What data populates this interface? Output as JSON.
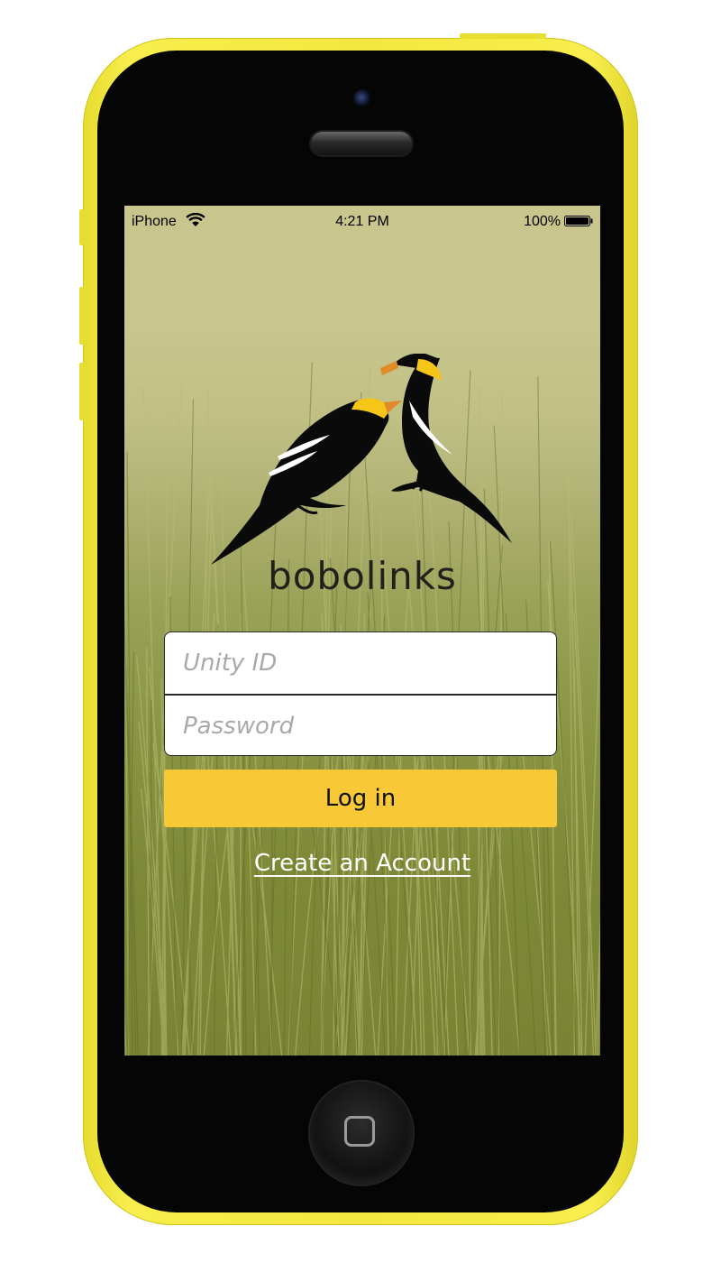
{
  "device": {
    "frame_color": "#f3e83e",
    "face_color": "#050505"
  },
  "status_bar": {
    "carrier": "iPhone",
    "wifi_icon": "wifi-icon",
    "time": "4:21 PM",
    "battery_percent": "100%",
    "battery_icon": "battery-full-icon",
    "battery_level": 1.0
  },
  "app": {
    "logo_icon": "bobolink-birds-logo",
    "name": "bobolinks"
  },
  "login_form": {
    "username_placeholder": "Unity ID",
    "username_value": "",
    "password_placeholder": "Password",
    "password_value": "",
    "login_label": "Log in",
    "login_color": "#f8c836",
    "create_account_label": "Create an Account"
  },
  "home_button": {
    "icon": "home-square-icon"
  }
}
